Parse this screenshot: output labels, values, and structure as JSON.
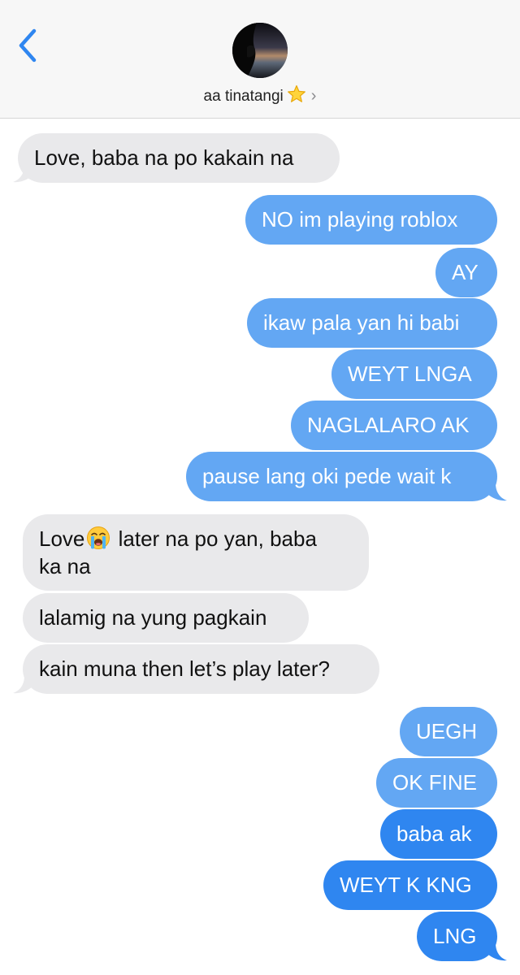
{
  "header": {
    "contact_name": "aa tinatangi",
    "star_icon": "star-emoji",
    "back_icon": "chevron-left-icon",
    "chevron_icon": "chevron-right-icon"
  },
  "colors": {
    "sent_bubble": "#63a7f3",
    "sent_bubble_latest": "#2f86f0",
    "received_bubble": "#e9e9eb",
    "back_accent": "#2f86f0"
  },
  "messages": [
    {
      "id": "m1",
      "from": "them",
      "text": "Love, baba na po kakain na"
    },
    {
      "id": "m2",
      "from": "me",
      "text": "NO im playing roblox"
    },
    {
      "id": "m3",
      "from": "me",
      "text": "AY"
    },
    {
      "id": "m4",
      "from": "me",
      "text": "ikaw pala yan hi babi"
    },
    {
      "id": "m5",
      "from": "me",
      "text": "WEYT LNGA"
    },
    {
      "id": "m6",
      "from": "me",
      "text": "NAGLALARO AK"
    },
    {
      "id": "m7",
      "from": "me",
      "text": "pause lang oki pede wait k"
    },
    {
      "id": "m8",
      "from": "them",
      "text_before": "Love",
      "emoji": "loudly-crying-face",
      "text_after": " later na po yan, baba",
      "text_line2": "ka na"
    },
    {
      "id": "m9",
      "from": "them",
      "text": "lalamig na yung pagkain"
    },
    {
      "id": "m10",
      "from": "them",
      "text": "kain muna then let’s play later?"
    },
    {
      "id": "m11",
      "from": "me",
      "text": "UEGH"
    },
    {
      "id": "m12",
      "from": "me",
      "text": "OK FINE"
    },
    {
      "id": "m13",
      "from": "me",
      "text": "baba ak"
    },
    {
      "id": "m14",
      "from": "me",
      "text": "WEYT K KNG"
    },
    {
      "id": "m15",
      "from": "me",
      "text": "LNG"
    }
  ]
}
